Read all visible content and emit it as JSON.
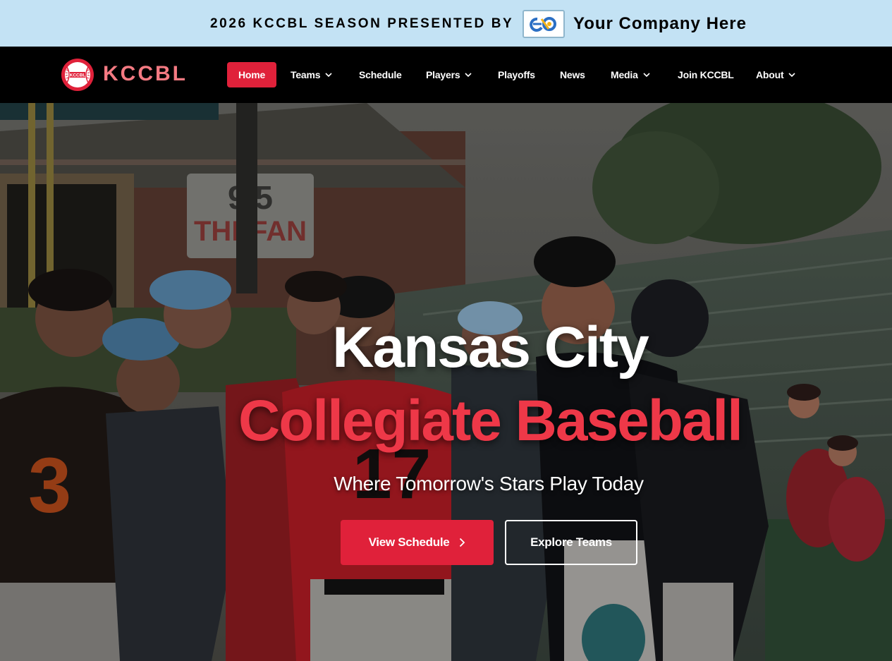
{
  "sponsor": {
    "text": "2026 KCCBL SEASON PRESENTED BY",
    "logo_icon": "sponsor-logo-icon",
    "company": "Your Company Here",
    "background": "#c3e2f4"
  },
  "brand": {
    "name": "KCCBL",
    "ball_label": "KCCBL",
    "color": "#f47a82"
  },
  "nav": {
    "accent": "#e0213a",
    "items": [
      {
        "label": "Home",
        "active": true,
        "dropdown": false
      },
      {
        "label": "Teams",
        "active": false,
        "dropdown": true
      },
      {
        "label": "Schedule",
        "active": false,
        "dropdown": false
      },
      {
        "label": "Players",
        "active": false,
        "dropdown": true
      },
      {
        "label": "Playoffs",
        "active": false,
        "dropdown": false
      },
      {
        "label": "News",
        "active": false,
        "dropdown": false
      },
      {
        "label": "Media",
        "active": false,
        "dropdown": true
      },
      {
        "label": "Join KCCBL",
        "active": false,
        "dropdown": false
      },
      {
        "label": "About",
        "active": false,
        "dropdown": true
      }
    ]
  },
  "hero": {
    "title_line1": "Kansas City",
    "title_line2": "Collegiate Baseball",
    "subtitle": "Where Tomorrow's Stars Play Today",
    "primary_button": "View Schedule",
    "secondary_button": "Explore Teams",
    "title_accent": "#ee3848",
    "background_image": "baseball-players-photo"
  }
}
